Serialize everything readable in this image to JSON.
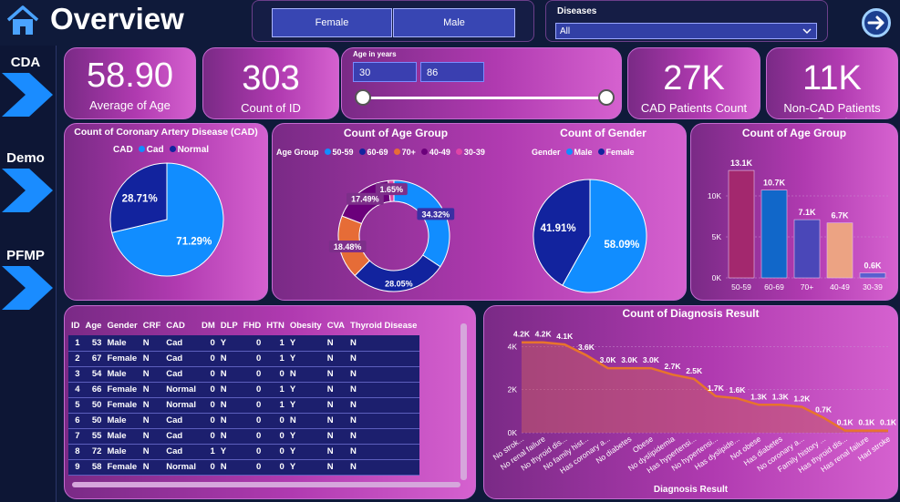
{
  "header": {
    "title": "Overview",
    "gender_buttons": [
      "Female",
      "Male"
    ],
    "diseases_label": "Diseases",
    "diseases_selected": "All"
  },
  "sidebar": {
    "items": [
      {
        "label": "CDA"
      },
      {
        "label": "Demo"
      },
      {
        "label": "PFMP"
      }
    ]
  },
  "kpis": {
    "avg_age": {
      "value": "58.90",
      "label": "Average of Age"
    },
    "count_id": {
      "value": "303",
      "label": "Count of ID"
    },
    "cad_patients": {
      "value": "27K",
      "label": "CAD Patients Count"
    },
    "noncad_patients": {
      "value": "11K",
      "label": "Non-CAD Patients Count"
    }
  },
  "age_slicer": {
    "label": "Age in years",
    "min": "30",
    "max": "86"
  },
  "colors": {
    "cad": "#118dff",
    "normal": "#12239e",
    "g5059": "#118dff",
    "g6069": "#12239e",
    "g70": "#e66c37",
    "g4049": "#6b007b",
    "g3039": "#e044a7"
  },
  "chart_data": [
    {
      "type": "pie",
      "title": "Count of Coronary Artery Disease (CAD)",
      "legend_title": "CAD",
      "categories": [
        "Cad",
        "Normal"
      ],
      "values": [
        71.29,
        28.71
      ],
      "labels": [
        "71.29%",
        "28.71%"
      ]
    },
    {
      "type": "pie",
      "variant": "donut",
      "title": "Count of Age Group",
      "legend_title": "Age Group",
      "categories": [
        "50-59",
        "60-69",
        "70+",
        "40-49",
        "30-39"
      ],
      "values": [
        34.32,
        28.05,
        18.48,
        17.49,
        1.65
      ],
      "labels": [
        "34.32%",
        "28.05%",
        "18.48%",
        "17.49%",
        "1.65%"
      ]
    },
    {
      "type": "pie",
      "title": "Count of Gender",
      "legend_title": "Gender",
      "categories": [
        "Male",
        "Female"
      ],
      "values": [
        58.09,
        41.91
      ],
      "labels": [
        "58.09%",
        "41.91%"
      ]
    },
    {
      "type": "bar",
      "title": "Count of Age Group",
      "categories": [
        "50-59",
        "60-69",
        "70+",
        "40-49",
        "30-39"
      ],
      "values": [
        13.1,
        10.7,
        7.1,
        6.7,
        0.6
      ],
      "labels": [
        "13.1K",
        "10.7K",
        "7.1K",
        "6.7K",
        "0.6K"
      ],
      "colors": [
        "#a3286e",
        "#1167c9",
        "#4a47b8",
        "#eca383",
        "#5a5fcf"
      ],
      "yticks": [
        "0K",
        "5K",
        "10K"
      ],
      "ylim": [
        0,
        14
      ]
    },
    {
      "type": "area",
      "title": "Count of Diagnosis Result",
      "xlabel": "Diagnosis Result",
      "categories": [
        "No strok...",
        "No renal failure",
        "No thyroid dis...",
        "No family hist...",
        "Has coronary a...",
        "No diabetes",
        "Obese",
        "No dyslipidemia",
        "Has hypertensi...",
        "No hypertensi...",
        "Has dyslipide...",
        "Not obese",
        "Has diabetes",
        "No coronary a...",
        "Family history ...",
        "Has thyroid dis...",
        "Has renal failure",
        "Had stroke"
      ],
      "values": [
        4.2,
        4.2,
        4.1,
        3.6,
        3.0,
        3.0,
        3.0,
        2.7,
        2.5,
        1.7,
        1.6,
        1.3,
        1.3,
        1.2,
        0.7,
        0.1,
        0.1,
        0.1
      ],
      "labels": [
        "4.2K",
        "4.2K",
        "4.1K",
        "3.6K",
        "3.0K",
        "3.0K",
        "3.0K",
        "2.7K",
        "2.5K",
        "1.7K",
        "1.6K",
        "1.3K",
        "1.3K",
        "1.2K",
        "0.7K",
        "0.1K",
        "0.1K",
        "0.1K"
      ],
      "yticks": [
        "0K",
        "2K",
        "4K"
      ],
      "ylim": [
        0,
        4.4
      ]
    }
  ],
  "table": {
    "columns": [
      "ID",
      "Age",
      "Gender",
      "CRF",
      "CAD",
      "DM",
      "DLP",
      "FHD",
      "HTN",
      "Obesity",
      "CVA",
      "Thyroid Disease"
    ],
    "rows": [
      [
        "1",
        "53",
        "Male",
        "N",
        "Cad",
        "0",
        "Y",
        "0",
        "1",
        "Y",
        "N",
        "N"
      ],
      [
        "2",
        "67",
        "Female",
        "N",
        "Cad",
        "0",
        "N",
        "0",
        "1",
        "Y",
        "N",
        "N"
      ],
      [
        "3",
        "54",
        "Male",
        "N",
        "Cad",
        "0",
        "N",
        "0",
        "0",
        "N",
        "N",
        "N"
      ],
      [
        "4",
        "66",
        "Female",
        "N",
        "Normal",
        "0",
        "N",
        "0",
        "1",
        "Y",
        "N",
        "N"
      ],
      [
        "5",
        "50",
        "Female",
        "N",
        "Normal",
        "0",
        "N",
        "0",
        "1",
        "Y",
        "N",
        "N"
      ],
      [
        "6",
        "50",
        "Male",
        "N",
        "Cad",
        "0",
        "N",
        "0",
        "0",
        "N",
        "N",
        "N"
      ],
      [
        "7",
        "55",
        "Male",
        "N",
        "Cad",
        "0",
        "N",
        "0",
        "0",
        "Y",
        "N",
        "N"
      ],
      [
        "8",
        "72",
        "Male",
        "N",
        "Cad",
        "1",
        "Y",
        "0",
        "0",
        "Y",
        "N",
        "N"
      ],
      [
        "9",
        "58",
        "Female",
        "N",
        "Normal",
        "0",
        "N",
        "0",
        "0",
        "Y",
        "N",
        "N"
      ]
    ]
  }
}
